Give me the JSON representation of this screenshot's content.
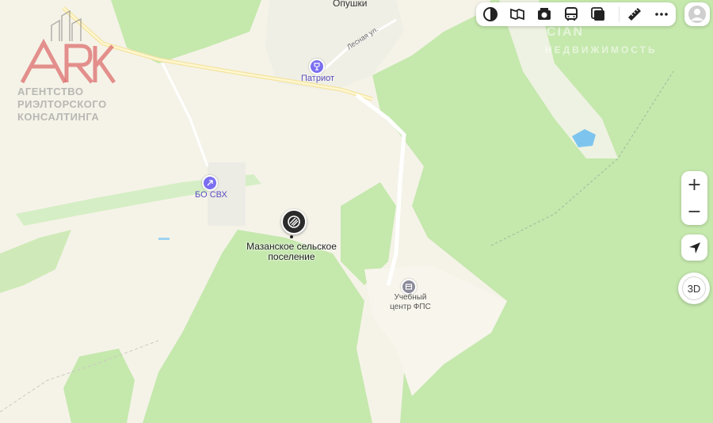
{
  "map": {
    "top_label": "Опушки",
    "street_label": "Лесная ул.",
    "poi_patriot": "Патриот",
    "poi_bo_svh": "БО СВХ",
    "place_name_line1": "Мазанское сельское",
    "place_name_line2": "поселение",
    "training_center_line1": "Учебный",
    "training_center_line2": "центр ФПС"
  },
  "watermark": {
    "logo_letters": "ARK",
    "line1": "АГЕНТСТВО",
    "line2": "РИЭЛТОРСКОГО",
    "line3": "КОНСАЛТИНГА",
    "right_mark_top": "CIAN",
    "right_mark_bottom": "НЕДВИЖИМОСТЬ"
  },
  "toolbar": {
    "buttons": [
      "layers-icon",
      "panorama-icon",
      "photo-icon",
      "transit-icon",
      "traffic-icon",
      "ruler-icon",
      "more-icon"
    ]
  },
  "controls": {
    "zoom_in": "+",
    "zoom_out": "−",
    "btn_3d": "3D"
  },
  "colors": {
    "forest": "#c5e8ad",
    "field": "#f5f3e8",
    "road_major": "#fbe9a4",
    "poi": "#7b6ff0",
    "water": "#7dc5ef"
  }
}
